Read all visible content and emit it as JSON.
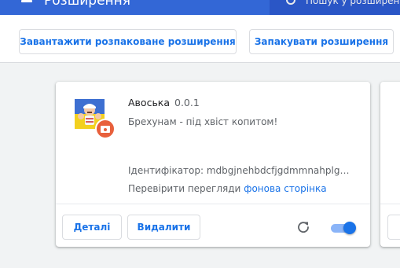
{
  "header": {
    "title": "Розширення",
    "search_placeholder": "Пошук у розширеннях"
  },
  "toolbar": {
    "load_unpacked_label": "Завантажити розпаковане розширення",
    "pack_label": "Запакувати розширення"
  },
  "extension": {
    "name": "Авоська",
    "version": "0.0.1",
    "description": "Брехунам - під хвіст копитом!",
    "id_text": "Ідентифікатор: mdbgjnehbdcfjgdmmnahplgmjkdlbkke",
    "inspect_label": "Перевірити перегляди",
    "inspect_link": "фонова сторінка",
    "details_label": "Деталі",
    "remove_label": "Видалити",
    "enabled": true,
    "icon": "extension-logo-icon",
    "badge_icon": "unpacked-badge-icon"
  },
  "colors": {
    "header_bg": "#3367d6",
    "accent": "#1a73e8",
    "badge": "#e8603c"
  }
}
